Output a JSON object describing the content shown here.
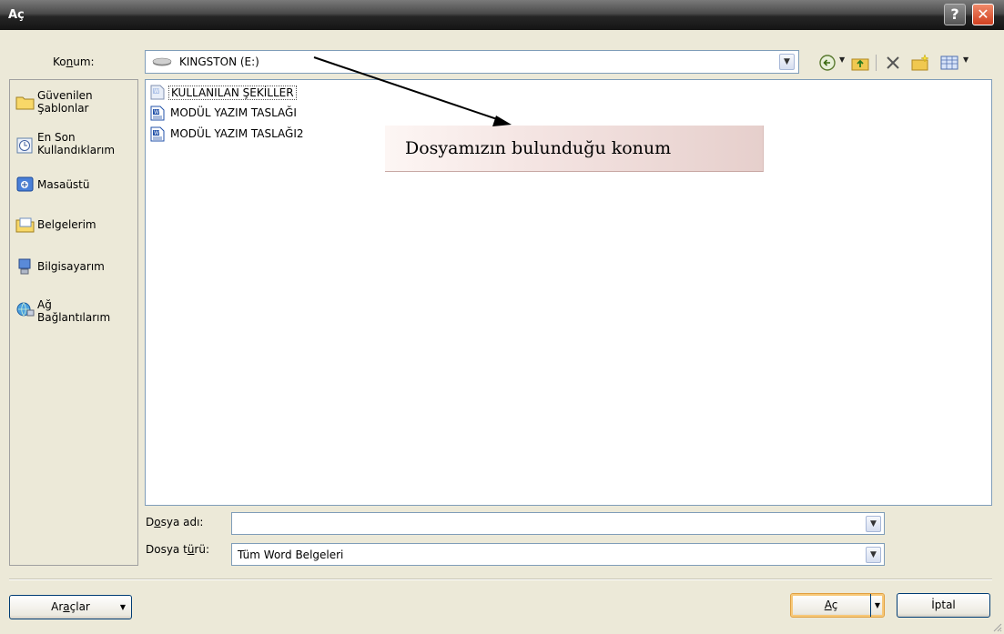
{
  "window": {
    "title": "Aç"
  },
  "titlebar_buttons": {
    "help": "?",
    "close": "✕"
  },
  "location": {
    "label_pre": "Ko",
    "label_ul": "n",
    "label_post": "um:",
    "value": "KINGSTON (E:)"
  },
  "toolbar": {
    "icons": [
      "back-icon",
      "up-folder-icon",
      "delete-icon",
      "new-folder-icon",
      "views-icon"
    ]
  },
  "places": [
    {
      "label": "Güvenilen\nŞablonlar",
      "icon": "trusted-templates-folder-icon"
    },
    {
      "label": "En Son\nKullandıklarım",
      "icon": "recent-documents-icon"
    },
    {
      "label": "Masaüstü",
      "icon": "desktop-icon"
    },
    {
      "label": "Belgelerim",
      "icon": "my-documents-icon"
    },
    {
      "label": "Bilgisayarım",
      "icon": "my-computer-icon"
    },
    {
      "label": "Ağ\nBağlantılarım",
      "icon": "network-places-icon"
    }
  ],
  "files": [
    {
      "name": "KULLANILAN ŞEKİLLER",
      "icon": "word-document-icon",
      "selected": true
    },
    {
      "name": "MODÜL YAZIM TASLAĞI",
      "icon": "word-document-icon",
      "selected": false
    },
    {
      "name": "MODÜL YAZIM TASLAĞI2",
      "icon": "word-document-icon",
      "selected": false
    }
  ],
  "annotation": {
    "text": "Dosyamızın bulunduğu konum"
  },
  "filename": {
    "label_pre": "D",
    "label_ul": "o",
    "label_post": "sya adı:",
    "value": ""
  },
  "filetype": {
    "label_pre": "Dosya t",
    "label_ul": "ü",
    "label_post": "rü:",
    "value": "Tüm Word Belgeleri"
  },
  "buttons": {
    "tools_pre": "Ar",
    "tools_ul": "a",
    "tools_post": "çlar",
    "open_ul": "A",
    "open_post": "ç",
    "cancel": "İptal"
  },
  "colors": {
    "accent": "#003c74",
    "title_bar": "#262626",
    "close": "#d04020"
  }
}
